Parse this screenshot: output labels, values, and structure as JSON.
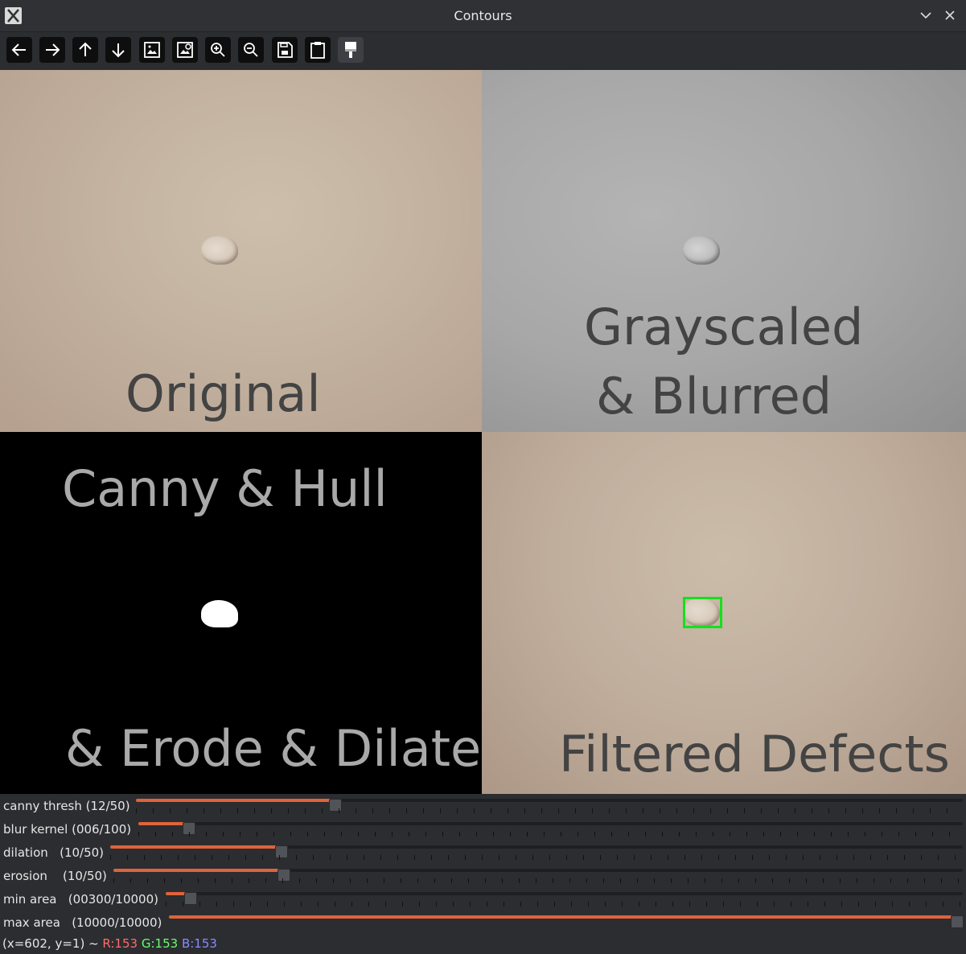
{
  "window": {
    "title": "Contours"
  },
  "toolbar": {
    "buttons": [
      {
        "name": "pan-left-icon"
      },
      {
        "name": "pan-right-icon"
      },
      {
        "name": "pan-up-icon"
      },
      {
        "name": "pan-down-icon"
      },
      {
        "name": "zoom-to-fit-icon"
      },
      {
        "name": "zoom-original-icon"
      },
      {
        "name": "zoom-in-icon"
      },
      {
        "name": "zoom-out-icon"
      },
      {
        "name": "save-icon"
      },
      {
        "name": "copy-to-clipboard-icon"
      },
      {
        "name": "properties-brush-icon"
      }
    ]
  },
  "panels": {
    "original": {
      "label": "Original"
    },
    "gray": {
      "label_line1": "Grayscaled",
      "label_line2": "& Blurred"
    },
    "canny": {
      "label_line1": "Canny & Hull",
      "label_line2": "& Erode & Dilate"
    },
    "filtered": {
      "label": "Filtered Defects"
    }
  },
  "trackbars": [
    {
      "label": "canny thresh (12/50)",
      "value": 12,
      "max": 50
    },
    {
      "label": "blur kernel (006/100)",
      "value": 6,
      "max": 100
    },
    {
      "label": "dilation   (10/50)",
      "value": 10,
      "max": 50
    },
    {
      "label": "erosion    (10/50)",
      "value": 10,
      "max": 50
    },
    {
      "label": "min area   (00300/10000)",
      "value": 300,
      "max": 10000
    },
    {
      "label": "max area   (10000/10000)",
      "value": 10000,
      "max": 10000
    }
  ],
  "status": {
    "coords": "(x=602, y=1) ~ ",
    "r": "R:153",
    "g": "G:153",
    "b": "B:153",
    "r_color": "#ff6b6b",
    "g_color": "#6bff6b",
    "b_color": "#8a8aff"
  },
  "colors": {
    "accent": "#e0633b",
    "detection_box": "#14e01a"
  }
}
